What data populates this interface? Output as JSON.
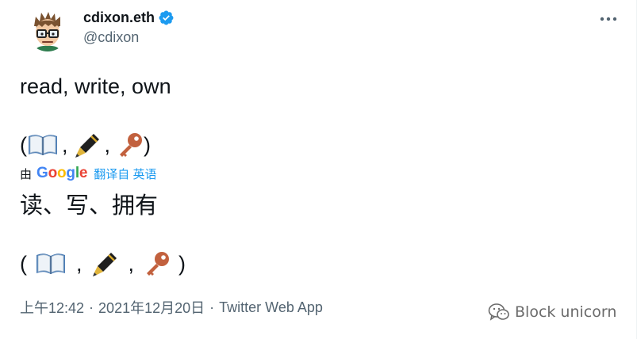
{
  "author": {
    "display_name": "cdixon.eth",
    "handle": "@cdixon"
  },
  "tweet": {
    "text": "read, write, own",
    "emoji_line": {
      "open": "(",
      "sep": ",",
      "close": ")",
      "emojis": [
        "book-icon",
        "pen-icon",
        "key-icon"
      ]
    }
  },
  "translation": {
    "prefix": "由",
    "provider": "Google",
    "link_text": "翻译自 英语",
    "text": "读、写、拥有"
  },
  "meta": {
    "time": "上午12:42",
    "dot": "·",
    "date": "2021年12月20日",
    "source": "Twitter Web App"
  },
  "watermark": {
    "text": "Block unicorn"
  },
  "colors": {
    "text": "#0f1419",
    "secondary": "#536471",
    "accent": "#1d9bf0",
    "verified": "#1d9bf0"
  }
}
